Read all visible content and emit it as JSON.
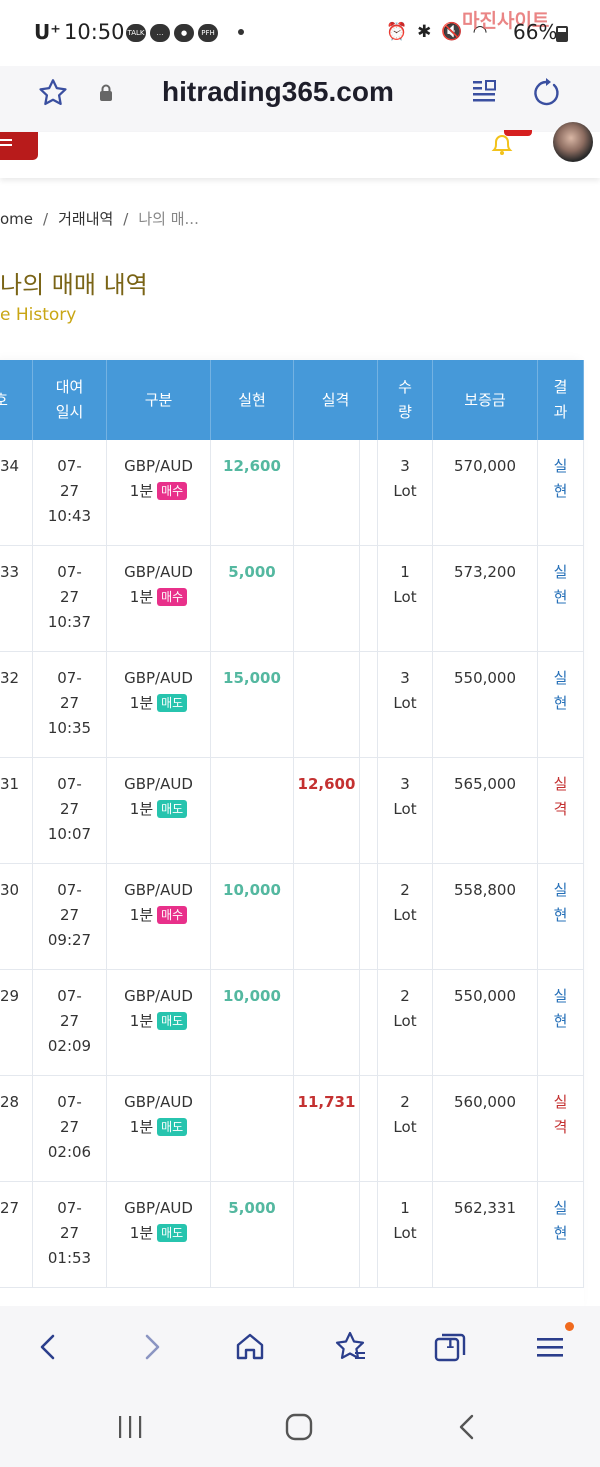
{
  "status_bar": {
    "carrier": "U⁺",
    "time": "10:50",
    "notifications": [
      "TALK",
      "…",
      "●",
      "PFH"
    ],
    "battery": "66%",
    "watermark": "마진사이트"
  },
  "browser": {
    "url": "hitrading365.com"
  },
  "breadcrumb": {
    "home": "ome",
    "section": "거래내역",
    "current": "나의 매..."
  },
  "page": {
    "title": "나의 매매 내역",
    "subtitle": "e History"
  },
  "table": {
    "headers": [
      "호",
      "대여\n일시",
      "구분",
      "실현",
      "실격",
      "수\n량",
      "보증금",
      "결\n과"
    ],
    "rows": [
      {
        "no": "34",
        "date": "07-\n27\n10:43",
        "pair": "GBP/AUD",
        "period": "1분",
        "side": "매수",
        "side_type": "buy",
        "profit": "12,600",
        "loss": "",
        "qty": "3\nLot",
        "deposit": "570,000",
        "result": "실\n현",
        "result_type": "win"
      },
      {
        "no": "33",
        "date": "07-\n27\n10:37",
        "pair": "GBP/AUD",
        "period": "1분",
        "side": "매수",
        "side_type": "buy",
        "profit": "5,000",
        "loss": "",
        "qty": "1\nLot",
        "deposit": "573,200",
        "result": "실\n현",
        "result_type": "win"
      },
      {
        "no": "32",
        "date": "07-\n27\n10:35",
        "pair": "GBP/AUD",
        "period": "1분",
        "side": "매도",
        "side_type": "sell",
        "profit": "15,000",
        "loss": "",
        "qty": "3\nLot",
        "deposit": "550,000",
        "result": "실\n현",
        "result_type": "win"
      },
      {
        "no": "31",
        "date": "07-\n27\n10:07",
        "pair": "GBP/AUD",
        "period": "1분",
        "side": "매도",
        "side_type": "sell",
        "profit": "",
        "loss": "12,600",
        "qty": "3\nLot",
        "deposit": "565,000",
        "result": "실\n격",
        "result_type": "loss"
      },
      {
        "no": "30",
        "date": "07-\n27\n09:27",
        "pair": "GBP/AUD",
        "period": "1분",
        "side": "매수",
        "side_type": "buy",
        "profit": "10,000",
        "loss": "",
        "qty": "2\nLot",
        "deposit": "558,800",
        "result": "실\n현",
        "result_type": "win"
      },
      {
        "no": "29",
        "date": "07-\n27\n02:09",
        "pair": "GBP/AUD",
        "period": "1분",
        "side": "매도",
        "side_type": "sell",
        "profit": "10,000",
        "loss": "",
        "qty": "2\nLot",
        "deposit": "550,000",
        "result": "실\n현",
        "result_type": "win"
      },
      {
        "no": "28",
        "date": "07-\n27\n02:06",
        "pair": "GBP/AUD",
        "period": "1분",
        "side": "매도",
        "side_type": "sell",
        "profit": "",
        "loss": "11,731",
        "qty": "2\nLot",
        "deposit": "560,000",
        "result": "실\n격",
        "result_type": "loss"
      },
      {
        "no": "27",
        "date": "07-\n27\n01:53",
        "pair": "GBP/AUD",
        "period": "1분",
        "side": "매도",
        "side_type": "sell",
        "profit": "5,000",
        "loss": "",
        "qty": "1\nLot",
        "deposit": "562,331",
        "result": "실\n현",
        "result_type": "win"
      }
    ]
  },
  "toolbar": {
    "tab_count": "1"
  },
  "colors": {
    "header_blue": "#4699d9",
    "profit_teal": "#54b8a0",
    "loss_red": "#c43131",
    "buy_pink": "#e8308a",
    "sell_teal": "#27c4ae",
    "title_gold": "#7a6416",
    "menu_red": "#b81b1b"
  }
}
